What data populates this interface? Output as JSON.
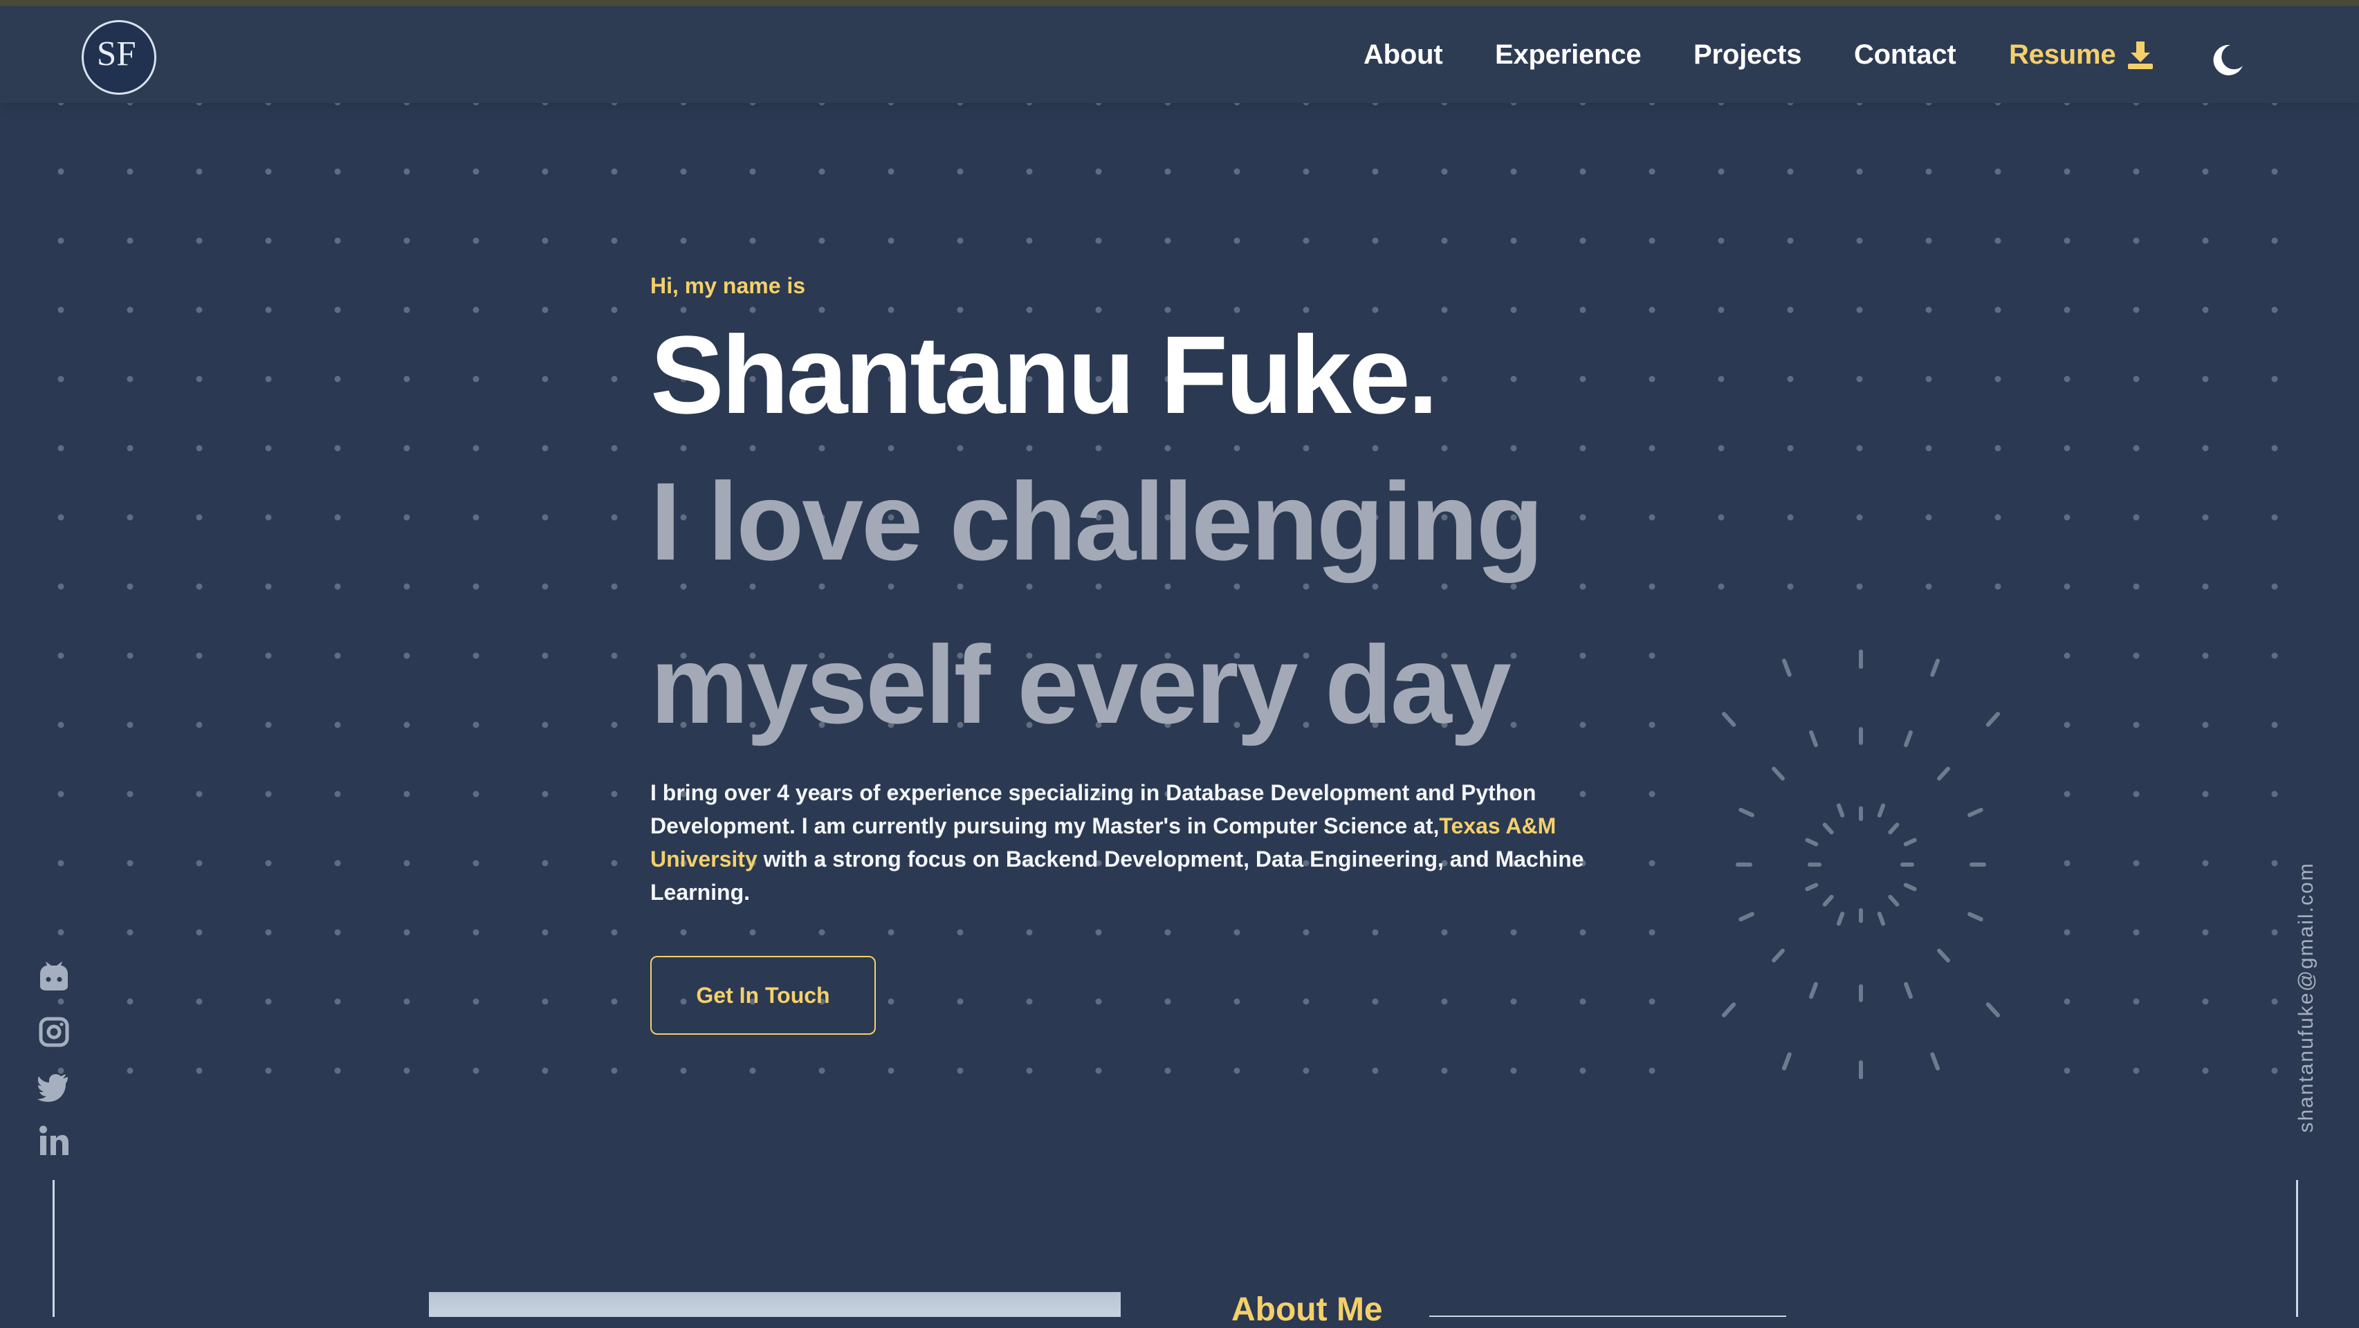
{
  "brand": {
    "logo_initials": "SF"
  },
  "nav": {
    "items": [
      {
        "label": "About"
      },
      {
        "label": "Experience"
      },
      {
        "label": "Projects"
      },
      {
        "label": "Contact"
      }
    ],
    "resume_label": "Resume",
    "resume_icon": "download-icon",
    "theme_icon": "moon-icon"
  },
  "hero": {
    "intro": "Hi, my name is",
    "name": "Shantanu Fuke.",
    "tagline": [
      "I love challenging",
      "myself every day"
    ],
    "description": {
      "part1": "I bring over 4 years of experience specializing in Database Development and Python Development. I am currently pursuing my Master's in Computer Science at,",
      "highlight": "Texas A&M University",
      "part2": " with a strong focus on Backend Development, Data Engineering, and Machine Learning."
    },
    "cta_label": "Get In Touch"
  },
  "social": [
    {
      "icon": "github-icon"
    },
    {
      "icon": "instagram-icon"
    },
    {
      "icon": "twitter-icon"
    },
    {
      "icon": "linkedin-icon"
    }
  ],
  "email": "shantanufuke@gmail.com",
  "about": {
    "heading": "About Me"
  },
  "colors": {
    "background": "#2b3a52",
    "header": "#2d3b53",
    "accent": "#f5d06a",
    "text": "#ffffff",
    "muted_text": "#a3a9b6"
  }
}
